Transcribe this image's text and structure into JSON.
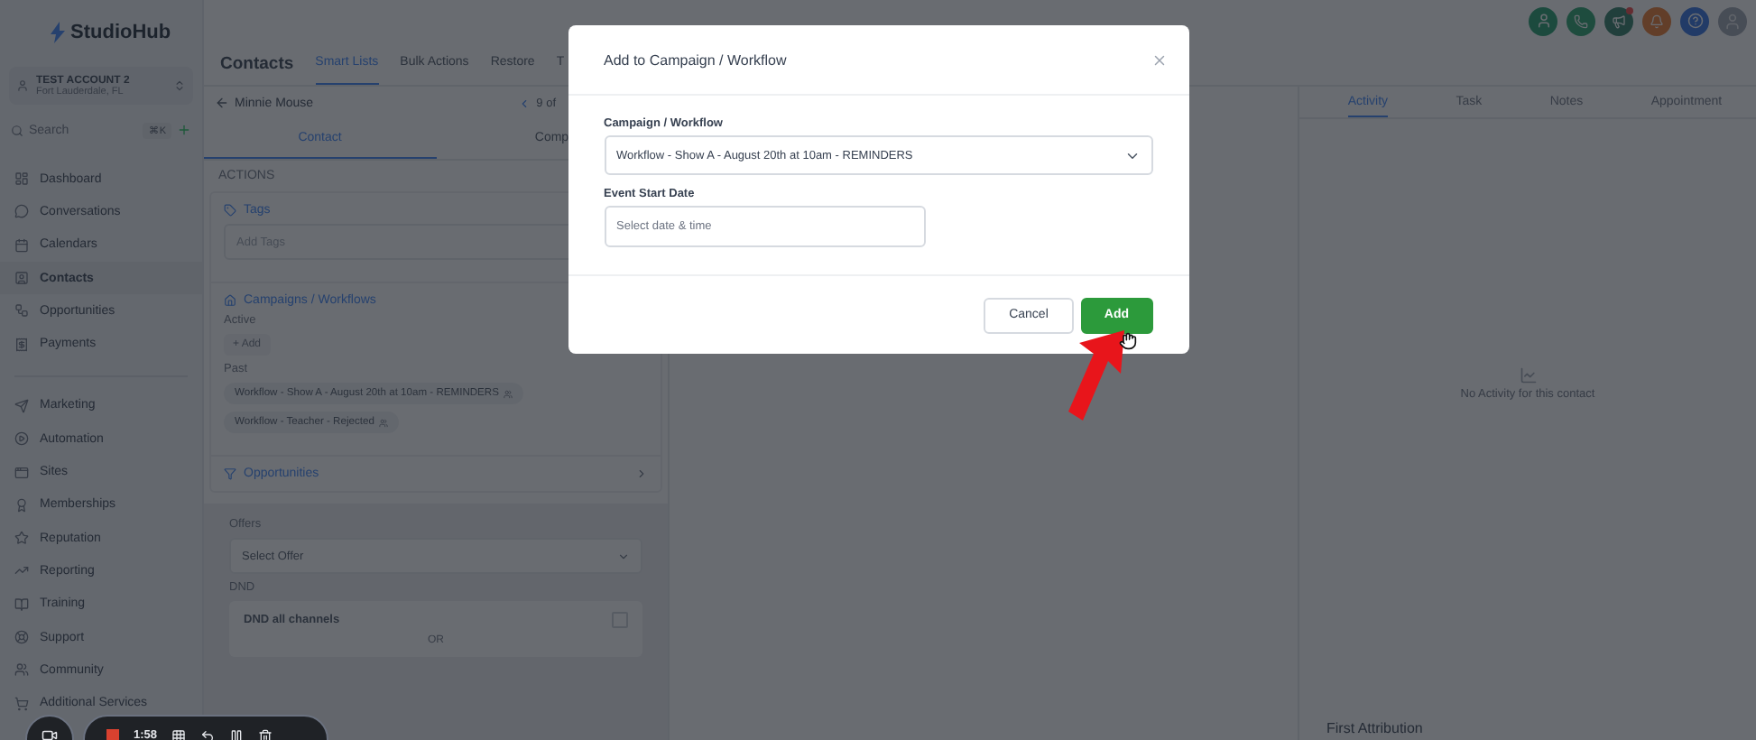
{
  "sidebar": {
    "logo": "StudioHub",
    "account": {
      "name": "TEST ACCOUNT 2",
      "location": "Fort Lauderdale, FL"
    },
    "search": {
      "placeholder": "Search",
      "shortcut": "⌘K"
    },
    "nav_groups": [
      {
        "items": [
          {
            "label": "Dashboard",
            "selected": false
          },
          {
            "label": "Conversations",
            "selected": false
          },
          {
            "label": "Calendars",
            "selected": false
          },
          {
            "label": "Contacts",
            "selected": true
          },
          {
            "label": "Opportunities",
            "selected": false
          },
          {
            "label": "Payments",
            "selected": false
          }
        ]
      },
      {
        "items": [
          {
            "label": "Marketing",
            "selected": false
          },
          {
            "label": "Automation",
            "selected": false
          },
          {
            "label": "Sites",
            "selected": false
          },
          {
            "label": "Memberships",
            "selected": false
          },
          {
            "label": "Reputation",
            "selected": false
          },
          {
            "label": "Reporting",
            "selected": false
          },
          {
            "label": "Training",
            "selected": false
          },
          {
            "label": "Support",
            "selected": false
          },
          {
            "label": "Community",
            "selected": false
          },
          {
            "label": "Additional Services",
            "selected": false
          }
        ]
      }
    ]
  },
  "header": {
    "title": "Contacts",
    "tabs": [
      {
        "label": "Smart Lists",
        "selected": true
      },
      {
        "label": "Bulk Actions",
        "selected": false
      },
      {
        "label": "Restore",
        "selected": false
      },
      {
        "label": "T",
        "selected": false
      }
    ]
  },
  "contact": {
    "back_label": "Minnie Mouse",
    "pager": "9 of",
    "tabs": [
      {
        "label": "Contact",
        "selected": true
      },
      {
        "label": "Comp",
        "selected": false
      }
    ],
    "section_title": "ACTIONS",
    "tags": {
      "title": "Tags",
      "placeholder": "Add Tags"
    },
    "campaigns": {
      "title": "Campaigns / Workflows",
      "active_label": "Active",
      "add_button": "+ Add",
      "past_label": "Past",
      "past": [
        "Workflow - Show A - August 20th at 10am - REMINDERS",
        "Workflow - Teacher - Rejected"
      ]
    },
    "opportunities": {
      "title": "Opportunities"
    },
    "offers": {
      "label": "Offers",
      "placeholder": "Select Offer"
    },
    "dnd": {
      "label": "DND",
      "all_channels": {
        "label": "DND all channels",
        "checked": false
      },
      "separator": "OR"
    }
  },
  "activity": {
    "tabs": [
      {
        "label": "Activity",
        "selected": true
      },
      {
        "label": "Task",
        "selected": false
      },
      {
        "label": "Notes",
        "selected": false
      },
      {
        "label": "Appointment",
        "selected": false
      }
    ],
    "empty_text": "No Activity for this contact",
    "attribution_title": "First Attribution"
  },
  "modal": {
    "title": "Add to Campaign / Workflow",
    "fields": [
      {
        "kind": "select",
        "label": "Campaign / Workflow",
        "value": "Workflow - Show A - August 20th at 10am - REMINDERS"
      },
      {
        "kind": "datetime",
        "label": "Event Start Date",
        "placeholder": "Select date & time"
      }
    ],
    "buttons": [
      {
        "label": "Cancel",
        "kind": "secondary"
      },
      {
        "label": "Add",
        "kind": "primary"
      }
    ]
  },
  "recorder": {
    "time": "1:58"
  }
}
